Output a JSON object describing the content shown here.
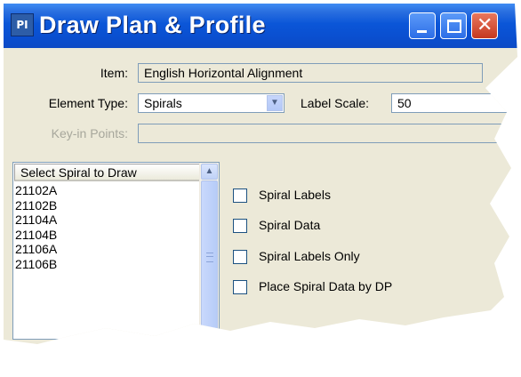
{
  "window": {
    "title": "Draw Plan & Profile",
    "app_icon": "application-icon",
    "controls": [
      "minimize-icon",
      "maximize-icon",
      "close-icon"
    ]
  },
  "form": {
    "item_label": "Item:",
    "item_value": "English Horizontal Alignment",
    "element_type_label": "Element Type:",
    "element_type_value": "Spirals",
    "label_scale_label": "Label Scale:",
    "label_scale_value": "50",
    "keyin_label": "Key-in Points:",
    "keyin_value": ""
  },
  "list": {
    "header": "Select Spiral to Draw",
    "items": [
      "21102A",
      "21102B",
      "21104A",
      "21104B",
      "21106A",
      "21106B"
    ]
  },
  "options": [
    {
      "label": "Spiral Labels",
      "checked": false
    },
    {
      "label": "Spiral Data",
      "checked": false
    },
    {
      "label": "Spiral Labels Only",
      "checked": false
    },
    {
      "label": "Place Spiral Data by DP",
      "checked": false
    }
  ],
  "colors": {
    "titlebar": "#0b56d8",
    "dialog_face": "#ece9d8",
    "close_button": "#d34a2f",
    "field_border": "#7f9db9"
  }
}
